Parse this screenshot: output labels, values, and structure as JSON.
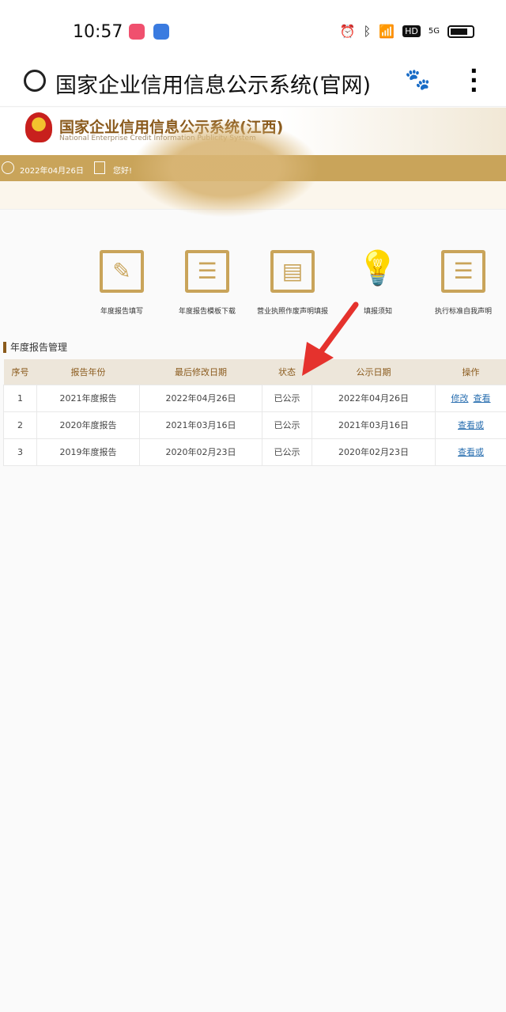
{
  "status_bar": {
    "time": "10:57",
    "network": "5G",
    "hd": "HD"
  },
  "browser": {
    "title": "国家企业信用信息公示系统(官网)"
  },
  "site": {
    "title": "国家企业信用信息公示系统(江西)",
    "subtitle": "National Enterprise Credit Information Publicity System",
    "date": "2022年04月26日",
    "greeting": "您好!"
  },
  "menu": [
    {
      "label": "年度报告填写",
      "icon": "pencil-icon"
    },
    {
      "label": "年度报告模板下载",
      "icon": "template-icon"
    },
    {
      "label": "营业执照作废声明填报",
      "icon": "inbox-icon"
    },
    {
      "label": "填报须知",
      "icon": "lightbulb-icon"
    },
    {
      "label": "执行标准自我声明",
      "icon": "document-icon"
    }
  ],
  "section_title": "年度报告管理",
  "table": {
    "headers": [
      "序号",
      "报告年份",
      "最后修改日期",
      "状态",
      "公示日期",
      "操作"
    ],
    "rows": [
      [
        "1",
        "2021年度报告",
        "2022年04月26日",
        "已公示",
        "2022年04月26日"
      ],
      [
        "2",
        "2020年度报告",
        "2021年03月16日",
        "已公示",
        "2021年03月16日"
      ],
      [
        "3",
        "2019年度报告",
        "2020年02月23日",
        "已公示",
        "2020年02月23日"
      ]
    ],
    "actions": [
      [
        "修改",
        "查看"
      ],
      [
        "查看或"
      ],
      [
        "查看或"
      ]
    ]
  },
  "colors": {
    "accent": "#c9a45a",
    "brown": "#8a5a1c",
    "arrow": "#e5322d"
  }
}
